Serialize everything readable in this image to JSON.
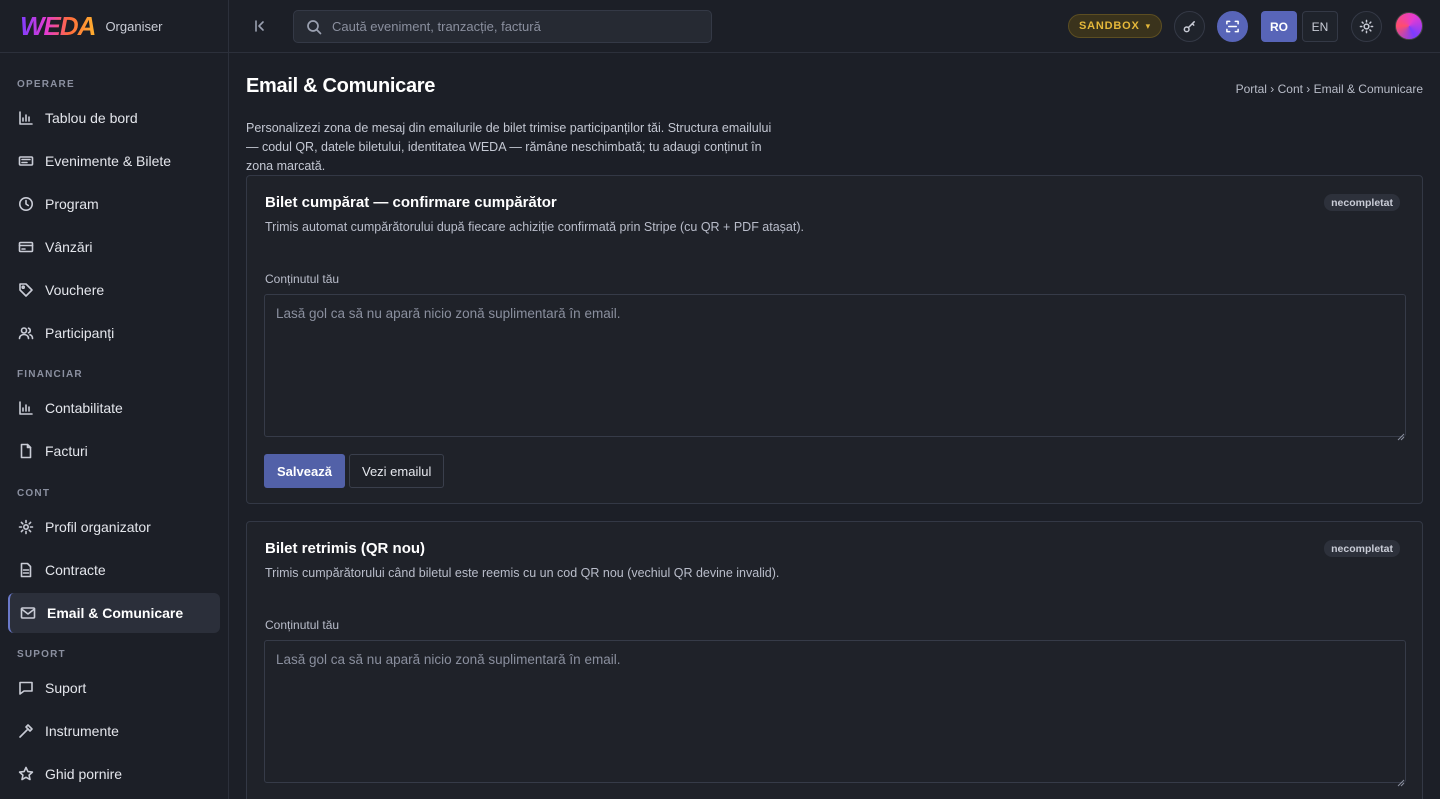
{
  "brand": {
    "logo_text": "WEDA",
    "subtitle": "Organiser"
  },
  "sidebar": {
    "sections": [
      {
        "label": "OPERARE"
      },
      {
        "label": "FINANCIAR"
      },
      {
        "label": "CONT"
      },
      {
        "label": "SUPORT"
      }
    ],
    "items": [
      {
        "label": "Tablou de bord",
        "icon": "bar-chart-icon"
      },
      {
        "label": "Evenimente & Bilete",
        "icon": "ticket-icon"
      },
      {
        "label": "Program",
        "icon": "clock-icon"
      },
      {
        "label": "Vânzări",
        "icon": "credit-card-icon"
      },
      {
        "label": "Vouchere",
        "icon": "tag-icon"
      },
      {
        "label": "Participanți",
        "icon": "users-icon"
      },
      {
        "label": "Contabilitate",
        "icon": "bar-chart-icon"
      },
      {
        "label": "Facturi",
        "icon": "file-icon"
      },
      {
        "label": "Profil organizator",
        "icon": "gear-icon"
      },
      {
        "label": "Contracte",
        "icon": "document-icon"
      },
      {
        "label": "Email & Comunicare",
        "icon": "mail-icon",
        "active": true
      },
      {
        "label": "Suport",
        "icon": "chat-icon"
      },
      {
        "label": "Instrumente",
        "icon": "hammer-icon"
      },
      {
        "label": "Ghid pornire",
        "icon": "star-icon"
      }
    ]
  },
  "topbar": {
    "search_placeholder": "Caută eveniment, tranzacție, factură",
    "environment": "SANDBOX",
    "languages": [
      "RO",
      "EN"
    ],
    "active_language": "RO"
  },
  "page": {
    "title": "Email & Comunicare",
    "breadcrumb": "Portal › Cont › Email & Comunicare",
    "intro": "Personalizezi zona de mesaj din emailurile de bilet trimise participanților tăi. Structura emailului — codul QR, datele biletului, identitatea WEDA — rămâne neschimbată; tu adaugi conținut în zona marcată."
  },
  "cards": [
    {
      "title": "Bilet cumpărat — confirmare cumpărător",
      "badge": "necompletat",
      "description": "Trimis automat cumpărătorului după fiecare achiziție confirmată prin Stripe (cu QR + PDF atașat).",
      "field_label": "Conținutul tău",
      "placeholder": "Lasă gol ca să nu apară nicio zonă suplimentară în email.",
      "value": "",
      "save_label": "Salvează",
      "preview_label": "Vezi emailul"
    },
    {
      "title": "Bilet retrimis (QR nou)",
      "badge": "necompletat",
      "description": "Trimis cumpărătorului când biletul este reemis cu un cod QR nou (vechiul QR devine invalid).",
      "field_label": "Conținutul tău",
      "placeholder": "Lasă gol ca să nu apară nicio zonă suplimentară în email.",
      "value": ""
    }
  ],
  "colors": {
    "accent": "#5261a8",
    "sandbox": "#e5b83a",
    "background": "#1c1f27"
  }
}
